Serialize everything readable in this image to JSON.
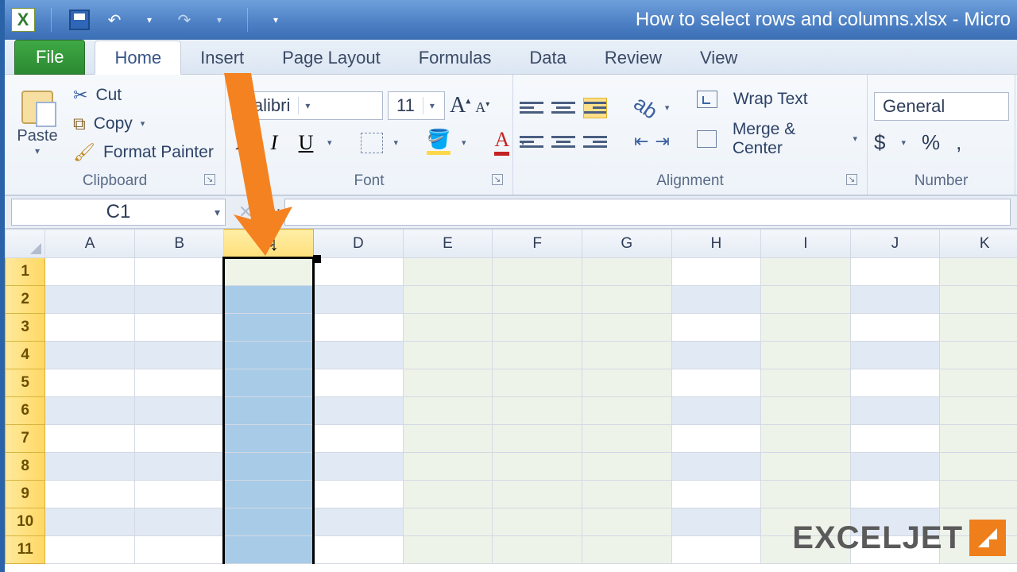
{
  "titlebar": {
    "document_title": "How to select rows and columns.xlsx - Micro"
  },
  "tabs": {
    "file": "File",
    "home": "Home",
    "insert": "Insert",
    "page_layout": "Page Layout",
    "formulas": "Formulas",
    "data": "Data",
    "review": "Review",
    "view": "View"
  },
  "ribbon": {
    "clipboard": {
      "label": "Clipboard",
      "paste": "Paste",
      "cut": "Cut",
      "copy": "Copy",
      "format_painter": "Format Painter"
    },
    "font": {
      "label": "Font",
      "name": "Calibri",
      "size": "11"
    },
    "alignment": {
      "label": "Alignment",
      "wrap_text": "Wrap Text",
      "merge_center": "Merge & Center"
    },
    "number": {
      "label": "Number",
      "format": "General"
    }
  },
  "formula_bar": {
    "name_box": "C1",
    "fx": "fx"
  },
  "columns": [
    "A",
    "B",
    "C",
    "D",
    "E",
    "F",
    "G",
    "H",
    "I",
    "J",
    "K"
  ],
  "rows": [
    "1",
    "2",
    "3",
    "4",
    "5",
    "6",
    "7",
    "8",
    "9",
    "10",
    "11"
  ],
  "selected_column": "C",
  "logo": "EXCELJET"
}
